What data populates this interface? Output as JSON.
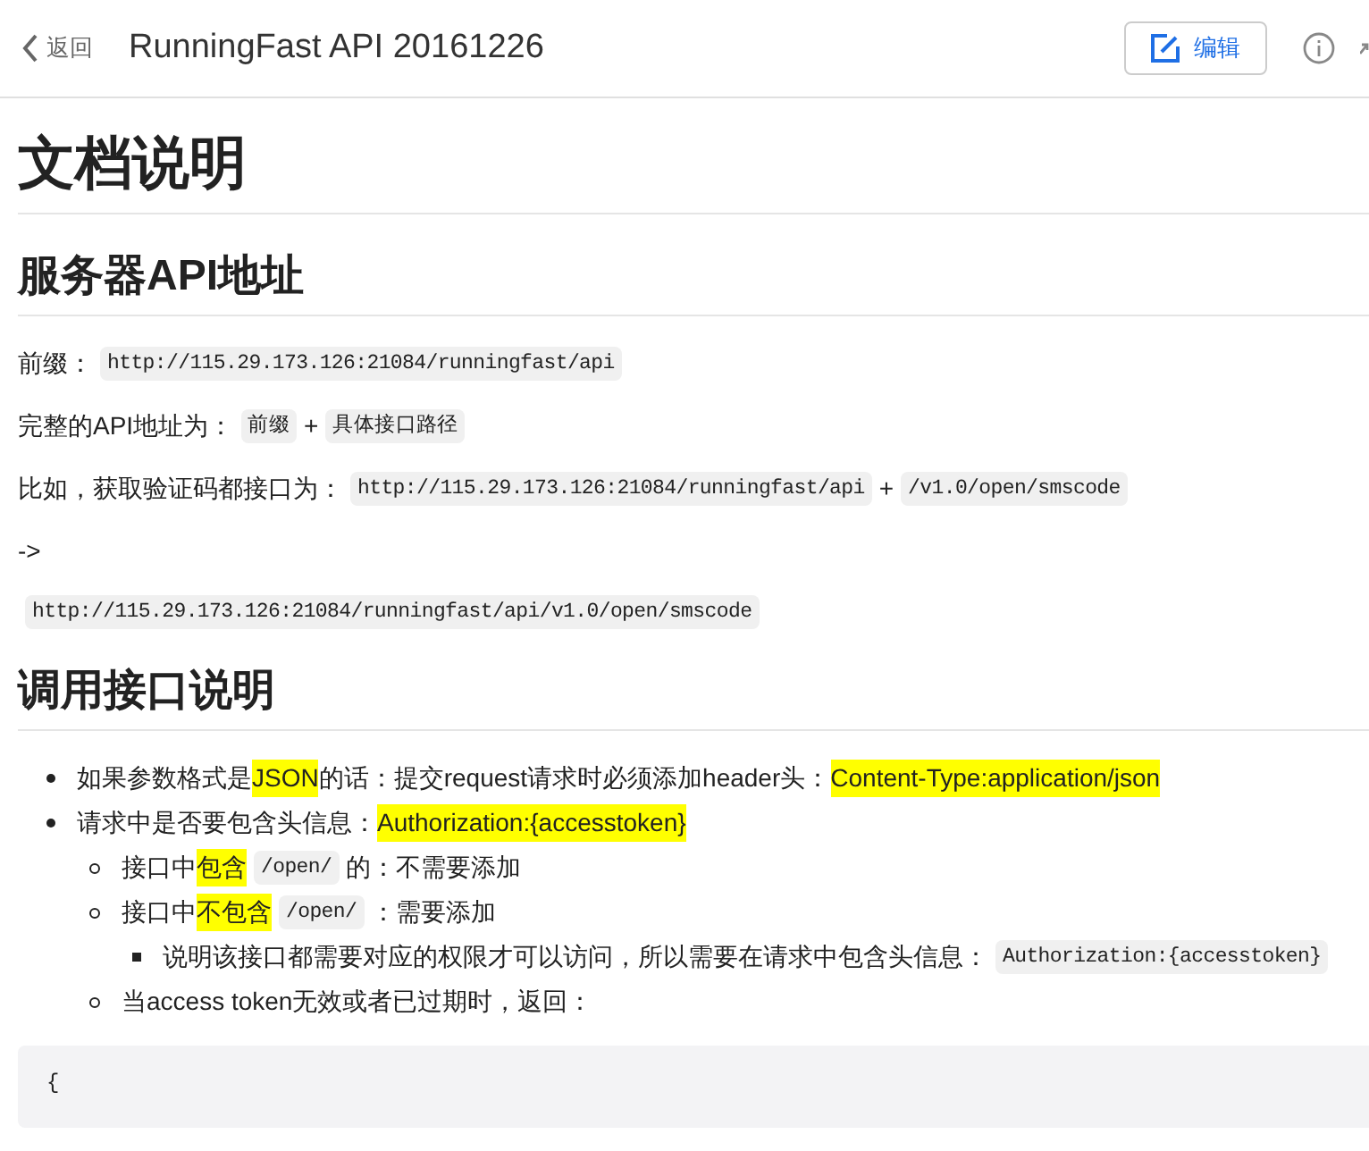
{
  "header": {
    "back_label": "返回",
    "title": "RunningFast API 20161226",
    "edit_button": "编辑"
  },
  "doc": {
    "title": "文档说明",
    "sections": [
      {
        "heading": "服务器API地址",
        "blocks": [
          {
            "kind": "paragraph",
            "segments": [
              {
                "kind": "text",
                "text": "前缀："
              },
              {
                "kind": "code",
                "text": "http://115.29.173.126:21084/runningfast/api"
              }
            ]
          },
          {
            "kind": "paragraph",
            "segments": [
              {
                "kind": "text",
                "text": "完整的API地址为："
              },
              {
                "kind": "code",
                "text": "前缀"
              },
              {
                "kind": "text",
                "text": "+"
              },
              {
                "kind": "code",
                "text": "具体接口路径"
              }
            ]
          },
          {
            "kind": "paragraph",
            "segments": [
              {
                "kind": "text",
                "text": "比如，获取验证码都接口为："
              },
              {
                "kind": "code",
                "text": "http://115.29.173.126:21084/runningfast/api"
              },
              {
                "kind": "text",
                "text": "+"
              },
              {
                "kind": "code",
                "text": "/v1.0/open/smscode"
              }
            ]
          },
          {
            "kind": "paragraph",
            "segments": [
              {
                "kind": "text",
                "text": "->"
              }
            ]
          },
          {
            "kind": "paragraph",
            "segments": [
              {
                "kind": "code",
                "text": "http://115.29.173.126:21084/runningfast/api/v1.0/open/smscode"
              }
            ]
          }
        ]
      },
      {
        "heading": "调用接口说明",
        "blocks": [
          {
            "kind": "list",
            "items": [
              {
                "segments": [
                  {
                    "kind": "text",
                    "text": "如果参数格式是"
                  },
                  {
                    "kind": "mark",
                    "text": "JSON"
                  },
                  {
                    "kind": "text",
                    "text": "的话：提交request请求时必须添加header头："
                  },
                  {
                    "kind": "mark",
                    "text": "Content-Type:application/json"
                  }
                ]
              },
              {
                "segments": [
                  {
                    "kind": "text",
                    "text": "请求中是否要包含头信息："
                  },
                  {
                    "kind": "mark",
                    "text": "Authorization:{accesstoken}"
                  }
                ],
                "children": [
                  {
                    "segments": [
                      {
                        "kind": "text",
                        "text": "接口中"
                      },
                      {
                        "kind": "mark",
                        "text": "包含"
                      },
                      {
                        "kind": "code",
                        "text": "/open/"
                      },
                      {
                        "kind": "text",
                        "text": "的：不需要添加"
                      }
                    ]
                  },
                  {
                    "segments": [
                      {
                        "kind": "text",
                        "text": "接口中"
                      },
                      {
                        "kind": "mark",
                        "text": "不包含"
                      },
                      {
                        "kind": "code",
                        "text": "/open/"
                      },
                      {
                        "kind": "text",
                        "text": "：需要添加"
                      }
                    ],
                    "children": [
                      {
                        "segments": [
                          {
                            "kind": "text",
                            "text": "说明该接口都需要对应的权限才可以访问，所以需要在请求中包含头信息："
                          },
                          {
                            "kind": "code",
                            "text": "Authorization:{accesstoken}"
                          }
                        ]
                      }
                    ]
                  },
                  {
                    "segments": [
                      {
                        "kind": "text",
                        "text": "当access token无效或者已过期时，返回："
                      }
                    ]
                  }
                ]
              }
            ]
          },
          {
            "kind": "code_block",
            "lines": [
              "{"
            ]
          }
        ]
      }
    ]
  }
}
